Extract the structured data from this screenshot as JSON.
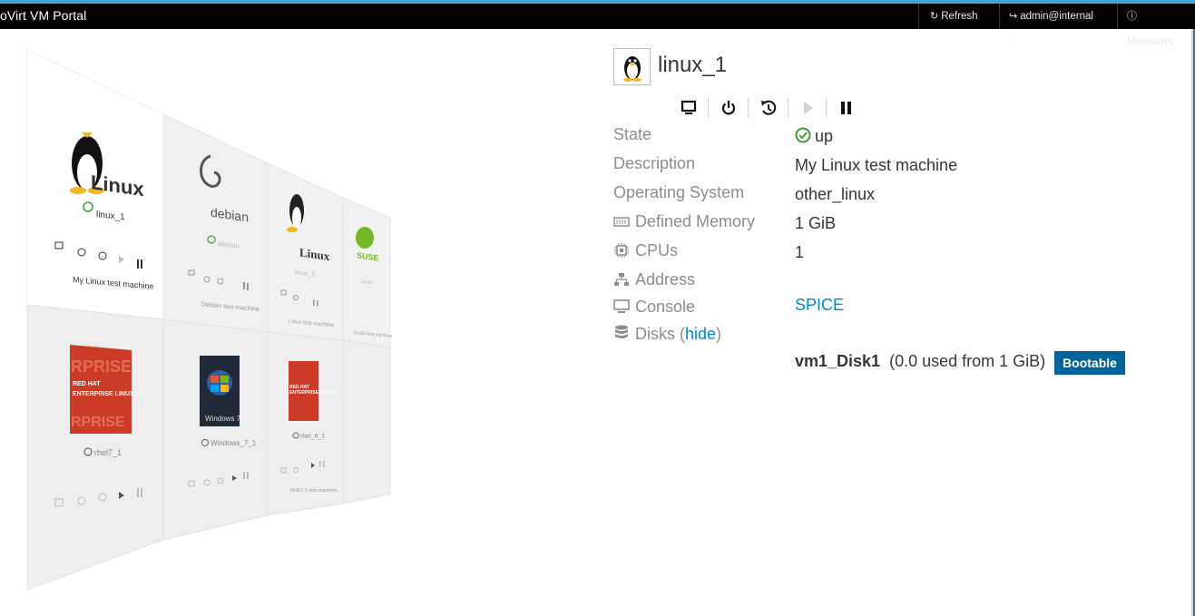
{
  "app": {
    "title": "oVirt VM Portal"
  },
  "navbar": {
    "refresh": "Refresh",
    "user": "admin@internal",
    "messages": "Messages"
  },
  "vm_cards": [
    {
      "name": "linux_1",
      "description": "My Linux test machine",
      "status": "up",
      "os_logo": "tux-linux-logo"
    },
    {
      "name": "debian",
      "description": "Debian test machine",
      "status": "up",
      "os_logo": "debian-logo"
    },
    {
      "name": "linux_2",
      "description": "Linux test machine",
      "status": "up",
      "os_logo": "tux-linux-logo"
    },
    {
      "name": "suse",
      "description": "SuSE test machine",
      "status": "up",
      "os_logo": "suse-logo"
    },
    {
      "name": "rhel7_1",
      "description": "",
      "status": "down",
      "os_logo": "rhel-logo"
    },
    {
      "name": "Windows_7_1",
      "description": "",
      "status": "down",
      "os_logo": "windows7-logo"
    },
    {
      "name": "rhel_6_1",
      "description": "RHEL 6 test machine",
      "status": "down",
      "os_logo": "rhel-logo"
    }
  ],
  "details": {
    "name": "linux_1",
    "labels": {
      "state": "State",
      "description": "Description",
      "os": "Operating System",
      "memory": "Defined Memory",
      "cpus": "CPUs",
      "address": "Address",
      "console": "Console",
      "disks": "Disks",
      "hide": "hide"
    },
    "values": {
      "state": "up",
      "description": "My Linux test machine",
      "os": "other_linux",
      "memory": "1 GiB",
      "cpus": "1",
      "address": "",
      "console": "SPICE"
    },
    "disk": {
      "name": "vm1_Disk1",
      "usage": "(0.0 used from 1 GiB)",
      "badge": "Bootable"
    }
  },
  "colors": {
    "accent": "#0088ce",
    "status_up": "#3f9c35",
    "navbar": "#030303",
    "badge": "#00659c"
  }
}
